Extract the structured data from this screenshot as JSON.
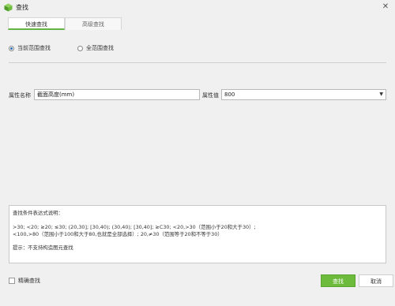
{
  "window": {
    "title": "查找",
    "icon": "cube-app-icon",
    "close_icon": "close-icon"
  },
  "tabs": [
    {
      "label": "快速查找",
      "active": true
    },
    {
      "label": "高级查找",
      "active": false
    }
  ],
  "scope": {
    "options": [
      {
        "label": "当前范围查找",
        "checked": true
      },
      {
        "label": "全范围查找",
        "checked": false
      }
    ]
  },
  "property": {
    "name_label": "属性名称",
    "name_value": "截面高度(mm)",
    "value_label": "属性值",
    "value_value": "800"
  },
  "help": {
    "heading": "查找条件表达式说明：",
    "line1": ">30; <20; ≥20; ≤30; (20,30]; [30,40); (30,40); [30,40]; ≥C30; <20,>30（范围小于20和大于30）;",
    "line2": "<100,>80（范围小于100和大于80,也就是全部选择）; 20,≠30（范围等于20和不等于30）",
    "tip": "提示：不支持构造图元查找"
  },
  "footer": {
    "exact_label": "精确查找",
    "exact_checked": false,
    "find_label": "查找",
    "cancel_label": "取消"
  },
  "colors": {
    "accent": "#6cbb3c",
    "tab_active_underline": "#62b545"
  }
}
